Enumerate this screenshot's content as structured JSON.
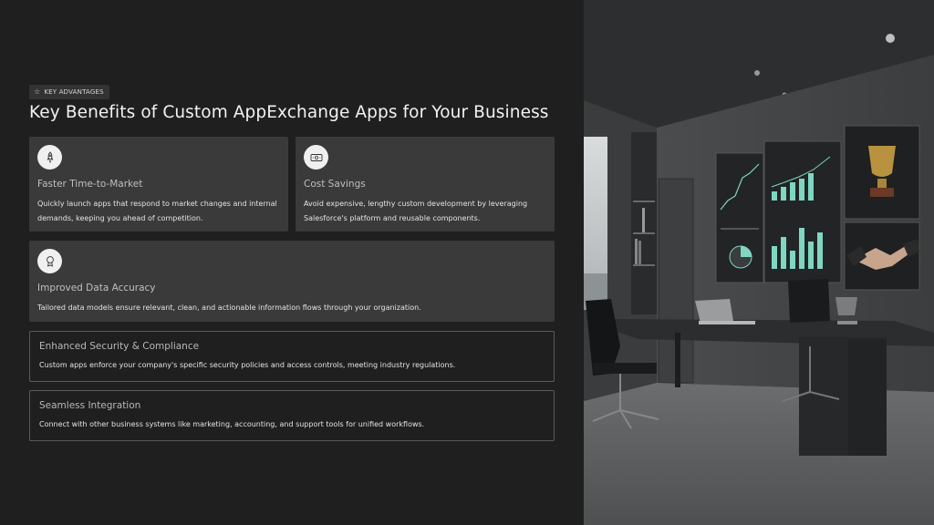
{
  "badge": {
    "icon": "star-outline-icon",
    "label": "KEY ADVANTAGES"
  },
  "title": "Key Benefits of Custom AppExchange Apps for Your Business",
  "cards": [
    {
      "icon": "rocket-icon",
      "title": "Faster Time-to-Market",
      "description": "Quickly launch apps that respond to market changes and internal demands, keeping you ahead of competition."
    },
    {
      "icon": "banknote-icon",
      "title": "Cost Savings",
      "description": "Avoid expensive, lengthy custom development by leveraging Salesforce's platform and reusable components."
    },
    {
      "icon": "award-icon",
      "title": "Improved Data Accuracy",
      "description": "Tailored data models ensure relevant, clean, and actionable information flows through your organization."
    },
    {
      "title": "Enhanced Security & Compliance",
      "description": "Custom apps enforce your company's specific security policies and access controls, meeting industry regulations."
    },
    {
      "title": "Seamless Integration",
      "description": "Connect with other business systems like marketing, accounting, and support tools for unified workflows."
    }
  ],
  "colors": {
    "background": "#1f1f1f",
    "card": "#3a3a3a",
    "accent_chart": "#7fd6c2"
  }
}
